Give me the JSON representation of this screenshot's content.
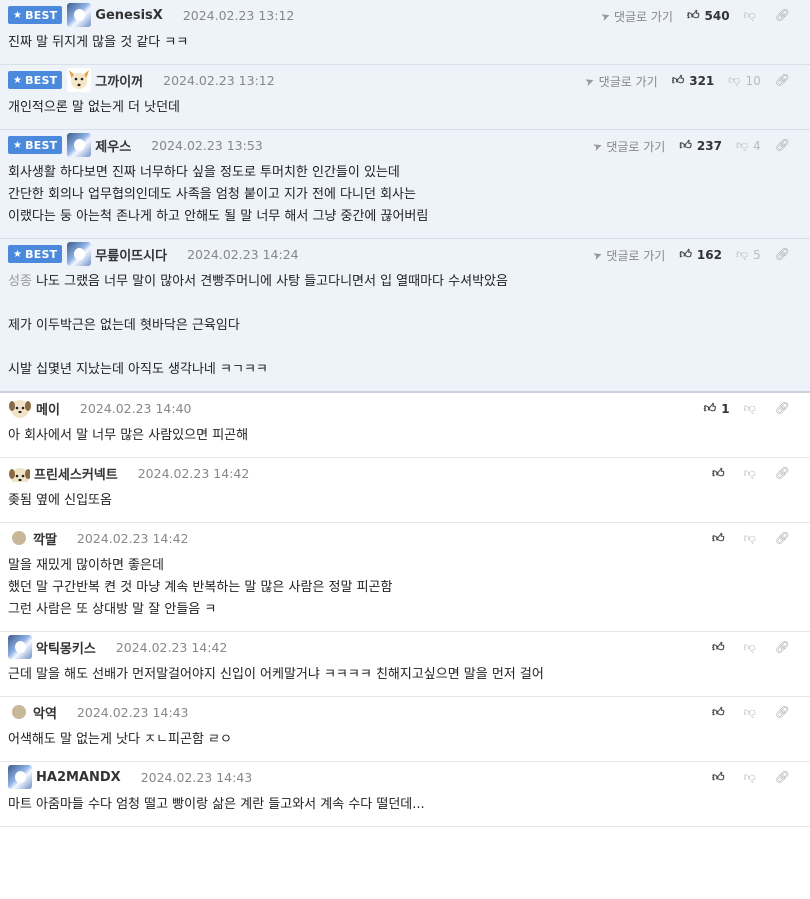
{
  "badge_label": "BEST",
  "reply_label": "댓글로 가기",
  "comments": [
    {
      "best": true,
      "nick": "GenesisX",
      "date": "2024.02.23 13:12",
      "up": "540",
      "down": "",
      "avatar": "bear",
      "lines": [
        "진짜 말 뒤지게 많을 것 같다 ㅋㅋ"
      ]
    },
    {
      "best": true,
      "nick": "그까이꺼",
      "date": "2024.02.23 13:12",
      "up": "321",
      "down": "10",
      "avatar": "fox",
      "lines": [
        "개인적으론 말 없는게 더 낫던데"
      ]
    },
    {
      "best": true,
      "nick": "제우스",
      "date": "2024.02.23 13:53",
      "up": "237",
      "down": "4",
      "avatar": "bear",
      "lines": [
        "회사생활 하다보면 진짜 너무하다 싶을 정도로 투머치한 인간들이 있는데",
        "간단한 회의나 업무협의인데도 사족을 엄청 붙이고 지가 전에 다니던 회사는",
        "이랬다는 둥 아는척 존나게 하고 안해도 될 말 너무 해서 그냥 중간에 끊어버림"
      ]
    },
    {
      "best": true,
      "nick": "무릎이뜨시다",
      "date": "2024.02.23 14:24",
      "up": "162",
      "down": "5",
      "avatar": "bear",
      "quote": "성종",
      "lines": [
        "나도 그랬음 너무 말이 많아서 견빵주머니에 사탕 들고다니면서 입 열때마다 수셔박았음",
        "",
        "제가 이두박근은 없는데 혓바닥은 근육임다",
        "",
        "시발 십몇년 지났는데 아직도 생각나네 ㅋㄱㅋㅋ"
      ]
    },
    {
      "best": false,
      "nick": "메이",
      "date": "2024.02.23 14:40",
      "up": "1",
      "down": "",
      "avatar": "dog",
      "lines": [
        "아 회사에서 말 너무 많은 사람있으면 피곤해"
      ]
    },
    {
      "best": false,
      "nick": "프린세스커넥트",
      "date": "2024.02.23 14:42",
      "up": "",
      "down": "",
      "avatar": "dog-small",
      "lines": [
        "좆됨 옆에 신입또옴"
      ]
    },
    {
      "best": false,
      "nick": "깍딸",
      "date": "2024.02.23 14:42",
      "up": "",
      "down": "",
      "avatar": "dot",
      "lines": [
        "말을 재밌게 많이하면 좋은데",
        "했던 말 구간반복 켠 것 마냥 계속 반복하는 말 많은 사람은 정말 피곤함",
        "그런 사람은 또 상대방 말 잘 안들음 ㅋ"
      ]
    },
    {
      "best": false,
      "nick": "악틱몽키스",
      "date": "2024.02.23 14:42",
      "up": "",
      "down": "",
      "avatar": "bear",
      "lines": [
        "근데 말을 해도 선배가 먼저말걸어야지 신입이 어케말거냐 ㅋㅋㅋㅋ 친해지고싶으면 말을 먼저 걸어"
      ]
    },
    {
      "best": false,
      "nick": "악역",
      "date": "2024.02.23 14:43",
      "up": "",
      "down": "",
      "avatar": "dot",
      "lines": [
        "어색해도 말 없는게 낫다 ㅈㄴ피곤함 ㄹㅇ"
      ]
    },
    {
      "best": false,
      "nick": "HA2MANDX",
      "date": "2024.02.23 14:43",
      "up": "",
      "down": "",
      "avatar": "bear",
      "lines": [
        "마트 아줌마들 수다 엄청 떨고 빵이랑 삶은 계란 들고와서 계속 수다 떨던데..."
      ]
    }
  ]
}
